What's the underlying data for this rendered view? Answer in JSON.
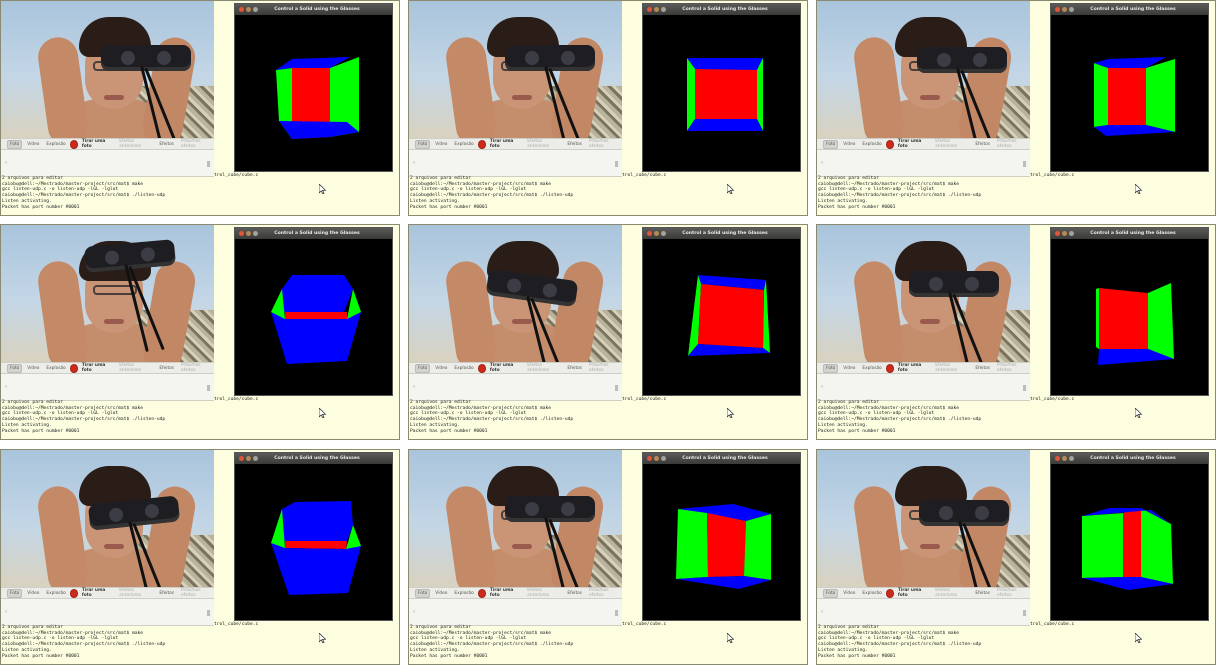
{
  "panels": [
    {
      "cube": "right"
    },
    {
      "cube": "front"
    },
    {
      "cube": "front-right"
    },
    {
      "cube": "top"
    },
    {
      "cube": "front-tilt"
    },
    {
      "cube": "front-right2"
    },
    {
      "cube": "top-tilt"
    },
    {
      "cube": "front-left"
    },
    {
      "cube": "left"
    }
  ],
  "window_title": "Control a Solid using the Glasses",
  "toolbar": {
    "foto": "Foto",
    "video": "Vídeo",
    "explosao": "Explosão",
    "tirar": "Tirar uma foto",
    "efeitos_ext": "Efeitos anteriores",
    "efeitos": "Efeitos",
    "proximos": "Próximos efeitos"
  },
  "filename": "trol_cube/cube.c",
  "terminal": [
    "2 arquivos para editar",
    "caiobu@dell:~/Mestrado/master-project/src/mat$ make",
    "gcc listen-udp.c -o listen-udp -lGL -lglut",
    "caiobu@dell:~/Mestrado/master-project/src/mat$ ./listen-udp",
    "Listen activating.",
    "Packet has port number #0001"
  ],
  "colors": {
    "red": "#ff0000",
    "green": "#00ff00",
    "blue": "#0000ff",
    "bg": "#000000",
    "panel": "#fdfde0"
  }
}
